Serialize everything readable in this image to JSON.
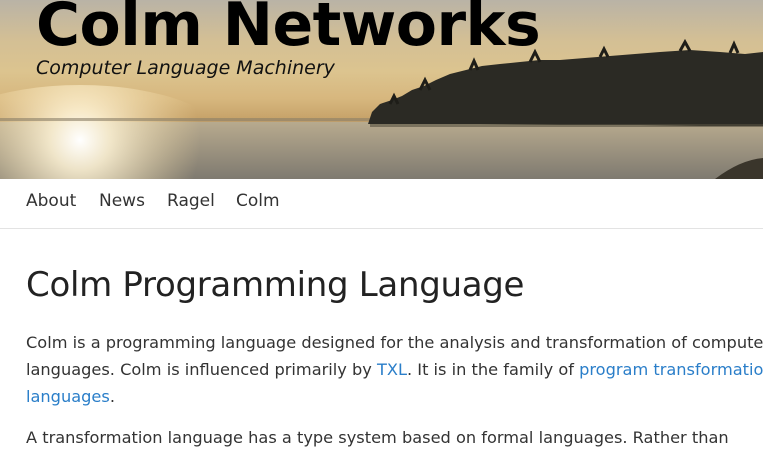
{
  "header": {
    "title": "Colm Networks",
    "tagline": "Computer Language Machinery"
  },
  "nav": {
    "items": [
      {
        "label": "About"
      },
      {
        "label": "News"
      },
      {
        "label": "Ragel"
      },
      {
        "label": "Colm"
      }
    ]
  },
  "main": {
    "heading": "Colm Programming Language",
    "p1": {
      "text1": "Colm is a programming language designed for the analysis and transformation of computer languages. Colm is influenced primarily by ",
      "link1": "TXL",
      "text2": ". It is in the family of ",
      "link2": "program transformation languages",
      "text3": "."
    },
    "p2": {
      "text": "A transformation language has a type system based on formal languages. Rather than"
    }
  },
  "colors": {
    "link": "#2a7ec9",
    "text": "#333333",
    "heading": "#222222"
  }
}
